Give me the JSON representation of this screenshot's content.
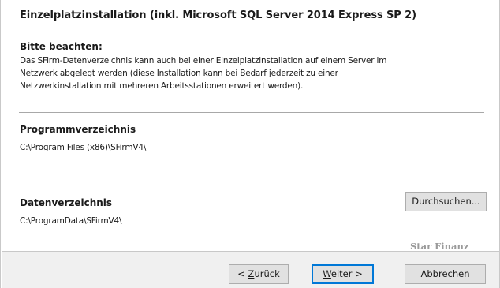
{
  "dialog": {
    "title": "Einzelplatzinstallation (inkl. Microsoft SQL Server 2014 Express SP 2)"
  },
  "notice": {
    "heading": "Bitte beachten:",
    "lines": [
      "Das SFirm-Datenverzeichnis kann auch bei einer Einzelplatzinstallation auf einem Server im",
      "Netzwerk abgelegt werden (diese Installation kann bei Bedarf jederzeit zu einer",
      "Netzwerkinstallation mit mehreren Arbeitsstationen erweitert werden)."
    ]
  },
  "program_dir": {
    "label": "Programmverzeichnis",
    "path": "C:\\Program Files (x86)\\SFirmV4\\"
  },
  "data_dir": {
    "label": "Datenverzeichnis",
    "path": "C:\\ProgramData\\SFirmV4\\",
    "browse_label": "Durchsuchen..."
  },
  "brand": "Star Finanz",
  "buttons": {
    "back": {
      "pre": "< ",
      "acc": "Z",
      "post": "urück"
    },
    "next": {
      "pre": "",
      "acc": "W",
      "post": "eiter >"
    },
    "cancel": "Abbrechen"
  }
}
